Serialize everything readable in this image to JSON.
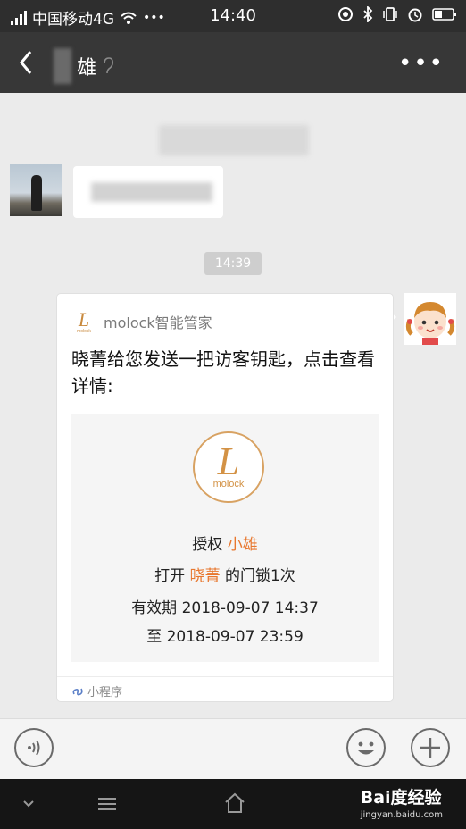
{
  "status_bar": {
    "carrier": "中国移动4G",
    "more": "•••",
    "time": "14:40"
  },
  "nav": {
    "title": "雄",
    "more": "•••"
  },
  "chat": {
    "time_label": "14:39",
    "card": {
      "app_name": "molock智能管家",
      "message": "晓菁给您发送一把访客钥匙，点击查看详情:",
      "logo_text": "molock",
      "auth_label": "授权",
      "auth_name": "小雄",
      "open_label": "打开",
      "open_owner": "晓菁",
      "open_suffix": "的门锁1次",
      "valid_label": "有效期 2018-09-07 14:37",
      "valid_until": "至 2018-09-07 23:59",
      "footer": "小程序"
    }
  },
  "watermark": {
    "brand": "Bai度经验",
    "url": "jingyan.baidu.com"
  },
  "colors": {
    "accent": "#e8772e",
    "logo_gold": "#d8a262",
    "nav_bg": "#373737"
  }
}
